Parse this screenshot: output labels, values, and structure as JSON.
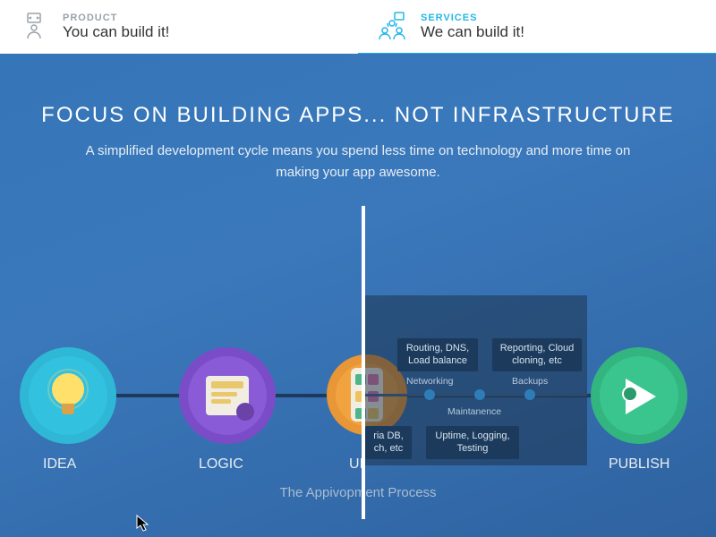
{
  "header": {
    "product": {
      "eyebrow": "PRODUCT",
      "title": "You can build it!"
    },
    "services": {
      "eyebrow": "SERVICES",
      "title": "We can build it!"
    }
  },
  "hero": {
    "title": "FOCUS ON BUILDING APPS... NOT INFRASTRUCTURE",
    "subtitle": "A simplified development cycle means you spend less time on technology and more time on making your app awesome.",
    "caption": "The Appivopment Process"
  },
  "flow": {
    "labels": {
      "idea": "IDEA",
      "logic": "LOGIC",
      "ui": "UI",
      "publish": "PUBLISH"
    }
  },
  "infra": {
    "routing": "Routing, DNS, Load balance",
    "reporting": "Reporting, Cloud cloning, etc",
    "networking": "Networking",
    "backups": "Backups",
    "maintenance": "Maintanence",
    "db": "ria DB, ch, etc",
    "uptime": "Uptime, Logging, Testing"
  }
}
